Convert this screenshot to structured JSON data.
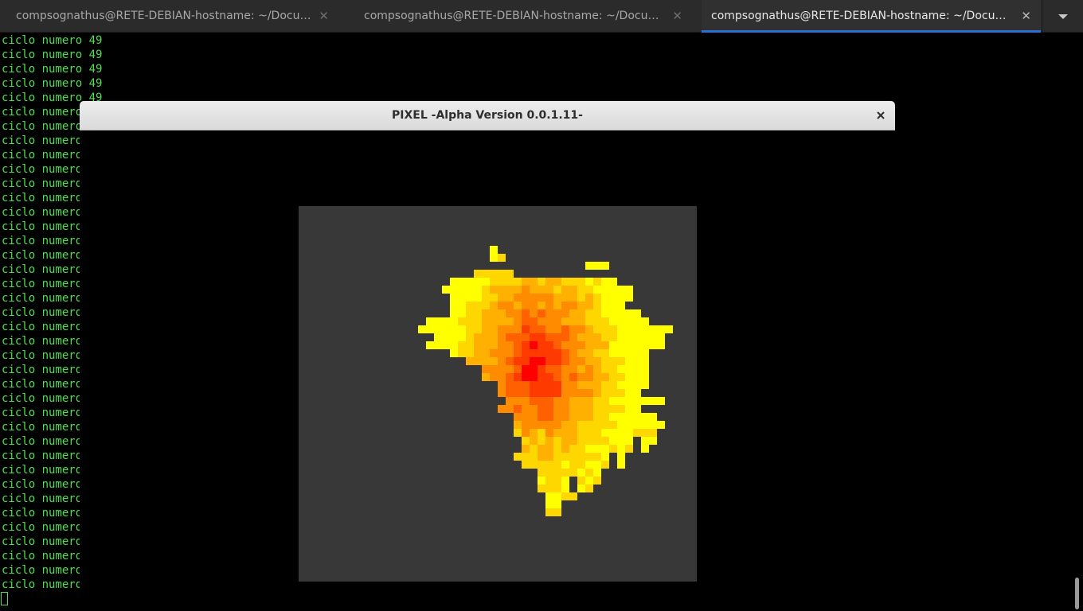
{
  "tabs": [
    {
      "label": "compsognathus@RETE-DEBIAN-hostname: ~/Documents",
      "active": false
    },
    {
      "label": "compsognathus@RETE-DEBIAN-hostname: ~/Documents",
      "active": false
    },
    {
      "label": "compsognathus@RETE-DEBIAN-hostname: ~/Documents",
      "active": true
    }
  ],
  "icons": {
    "tab_close": "close-icon",
    "tab_menu": "chevron-down-icon",
    "window_close": "close-icon"
  },
  "terminal": {
    "line_text": "ciclo numero 49",
    "visible_line_count": 39,
    "text_color": "#4ee04e",
    "background_color": "#000000"
  },
  "pixel_window": {
    "title": "PIXEL -Alpha Version 0.0.1.11-",
    "canvas_color": "#383838",
    "palette": {
      "yellow": "#ffff00",
      "gold": "#ffd700",
      "amber": "#ffb000",
      "orange": "#ff8c00",
      "dark_orange": "#ff6000",
      "red_orange": "#ff3a00",
      "red": "#ff0000"
    }
  },
  "accent_color": "#2a6fd6"
}
